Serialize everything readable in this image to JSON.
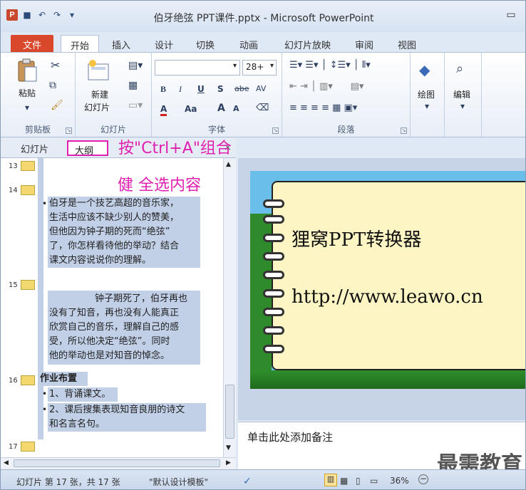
{
  "window": {
    "title": "伯牙绝弦 PPT课件.pptx - Microsoft PowerPoint",
    "minimize": "▭"
  },
  "qat": {
    "app": "P",
    "save": "💾",
    "undo": "↶",
    "redo": "↷"
  },
  "tabs": [
    "文件",
    "开始",
    "插入",
    "设计",
    "切换",
    "动画",
    "幻灯片放映",
    "审阅",
    "视图"
  ],
  "ribbon": {
    "clipboard": {
      "label": "剪贴板",
      "paste": "粘贴"
    },
    "slides": {
      "label": "幻灯片",
      "new_slide_1": "新建",
      "new_slide_2": "幻灯片"
    },
    "font": {
      "label": "字体",
      "size": "28+",
      "bold": "B",
      "italic": "I",
      "underline": "U",
      "shadow": "S",
      "strike": "abe",
      "spacing": "AV",
      "color": "A",
      "case": "Aa",
      "grow": "A",
      "shrink": "A"
    },
    "paragraph": {
      "label": "段落"
    },
    "drawing": {
      "label": "绘图"
    },
    "editing": {
      "label": "编辑"
    }
  },
  "pane": {
    "tab_slides": "幻灯片",
    "tab_outline": "大纲",
    "close": "×"
  },
  "annotations": {
    "line1": "按\"Ctrl+A\"组合",
    "line2": "健 全选内容"
  },
  "outline": {
    "n13": "13",
    "n14": "14",
    "n15": "15",
    "n16": "16",
    "n17": "17",
    "bullet": "•",
    "s14_lines": [
      "伯牙是一个技艺高超的音乐家，",
      "生活中应该不缺少别人的赞美，",
      "但他因为钟子期的死而“绝弦”",
      "了，你怎样看待他的举动？结合",
      "课文内容说说你的理解。"
    ],
    "s15_lines": [
      "钟子期死了，伯牙再也",
      "没有了知音，再也没有人能真正",
      "欣赏自己的音乐，理解自己的感",
      "受，所以他决定“绝弦”。同时",
      "他的举动也是对知音的悼念。"
    ],
    "s16_title": "作业布置",
    "s16_b1": "1、背诵课文。",
    "s16_b2_1": "2、课后搜集表现知音良朋的诗文",
    "s16_b2_2": "和名言名句。"
  },
  "slide": {
    "title": "狸窝PPT转换器",
    "url": "http://www.leawo.cn"
  },
  "notes": {
    "placeholder": "单击此处添加备注",
    "watermark": "最需教育"
  },
  "status": {
    "slide_info": "幻灯片 第 17 张，共 17 张",
    "theme": "\"默认设计模板\"",
    "zoom": "36%"
  }
}
